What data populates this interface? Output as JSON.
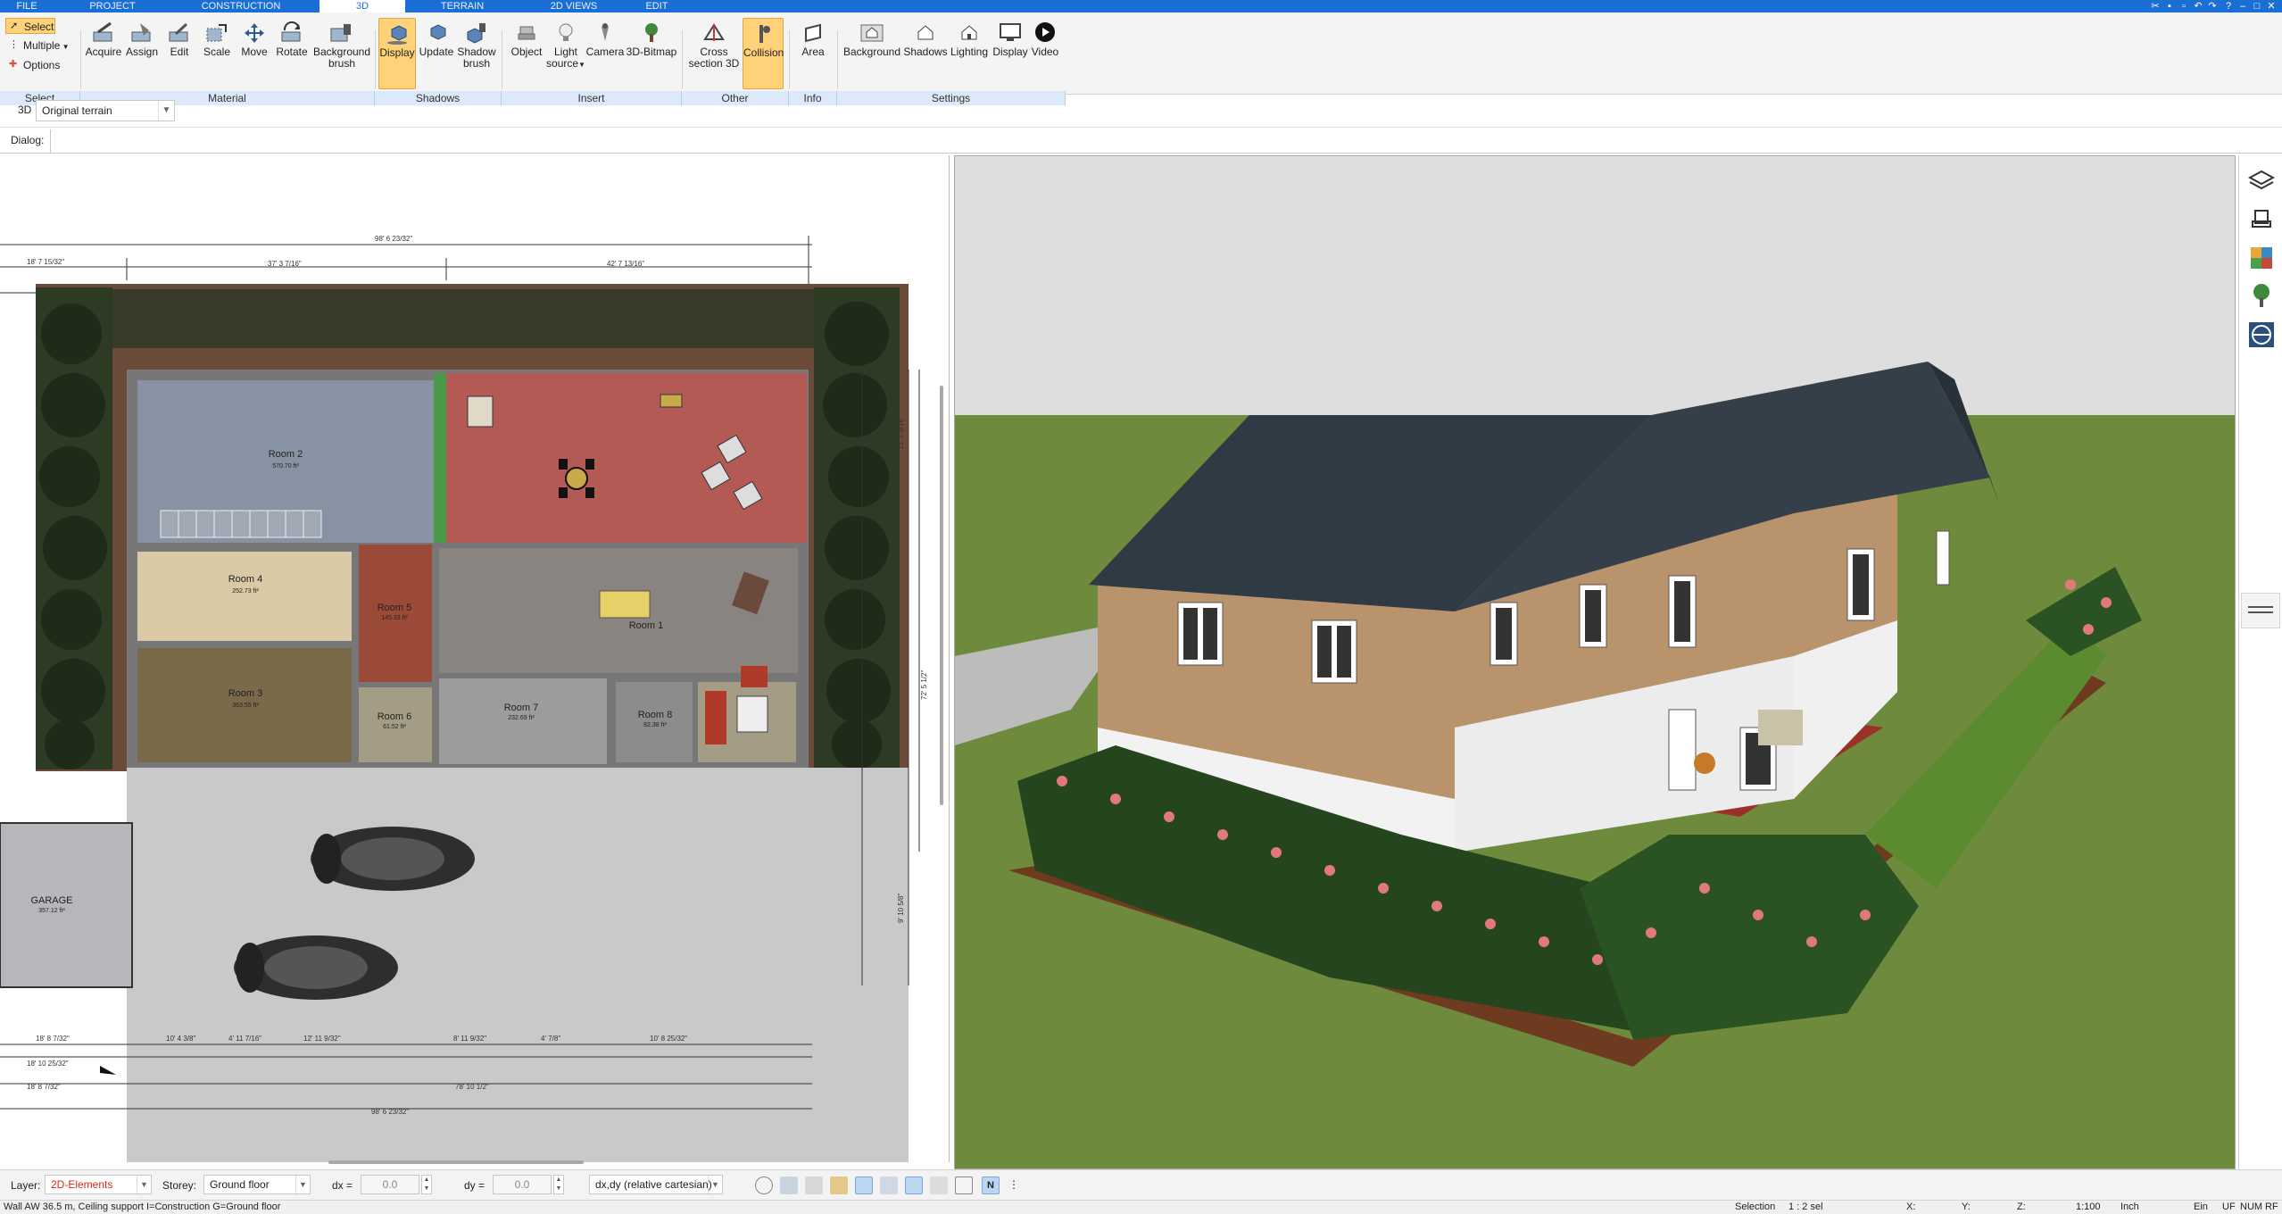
{
  "tabs": [
    {
      "label": "FILE"
    },
    {
      "label": "PROJECT"
    },
    {
      "label": "CONSTRUCTION"
    },
    {
      "label": "3D"
    },
    {
      "label": "TERRAIN"
    },
    {
      "label": "2D VIEWS"
    },
    {
      "label": "EDIT"
    }
  ],
  "ribbon": {
    "select_group": {
      "select": "Select",
      "multiple": "Multiple",
      "options": "Options",
      "caption": "Select"
    },
    "material_group": {
      "acquire": "Acquire",
      "assign": "Assign",
      "edit": "Edit",
      "scale": "Scale",
      "move": "Move",
      "rotate": "Rotate",
      "background_brush_1": "Background",
      "background_brush_2": "brush",
      "caption": "Material"
    },
    "shadows_group": {
      "display": "Display",
      "update": "Update",
      "shadow_brush_1": "Shadow",
      "shadow_brush_2": "brush",
      "caption": "Shadows"
    },
    "insert_group": {
      "object": "Object",
      "light_source_1": "Light",
      "light_source_2": "source",
      "camera": "Camera",
      "bitmap": "3D-Bitmap",
      "caption": "Insert"
    },
    "other_group": {
      "cross_section_1": "Cross",
      "cross_section_2": "section 3D",
      "collision": "Collision",
      "caption": "Other"
    },
    "info_group": {
      "area": "Area",
      "caption": "Info"
    },
    "settings_group": {
      "background": "Background",
      "shadows": "Shadows",
      "lighting": "Lighting",
      "display": "Display",
      "video": "Video",
      "caption": "Settings"
    }
  },
  "view_row": {
    "mode": "3D",
    "terrain_value": "Original terrain"
  },
  "dialog_row": {
    "label": "Dialog:"
  },
  "plan": {
    "rooms": [
      {
        "name": "Room 2",
        "area": "570.70 ft²"
      },
      {
        "name": "Room 4",
        "area": "252.73 ft²"
      },
      {
        "name": "Room 3",
        "area": "363.55 ft²"
      },
      {
        "name": "Room 5",
        "area": "145.33 ft²"
      },
      {
        "name": "Room 1",
        "area": ""
      },
      {
        "name": "Room 6",
        "area": "61.52 ft²"
      },
      {
        "name": "Room 7",
        "area": "232.69 ft²"
      },
      {
        "name": "Room 8",
        "area": "82.38 ft²"
      },
      {
        "name": "GARAGE",
        "area": "357.12 ft²"
      }
    ],
    "dims_top": [
      "98' 6 23/32\"",
      "18' 7 15/32\"",
      "37' 3 7/16\"",
      "42' 7 13/16\""
    ],
    "dims_bottom": [
      "18' 8 7/32\"",
      "10' 4 3/8\"",
      "4' 11 7/16\"",
      "12' 11 9/32\"",
      "8' 11 9/32\"",
      "4' 7/8\"",
      "10' 8 25/32\"",
      "18' 10 25/32\"",
      "18' 8 7/32\"",
      "78' 10 1/2\"",
      "98' 6 23/32\""
    ],
    "dims_right": [
      "72' 5 1/2\"",
      "13' 1 3/16\"",
      "9' 10 5/8\""
    ]
  },
  "bottom": {
    "layer_label": "Layer:",
    "layer_value": "2D-Elements",
    "storey_label": "Storey:",
    "storey_value": "Ground floor",
    "dx_label": "dx =",
    "dx_value": "0.0",
    "dy_label": "dy =",
    "dy_value": "0.0",
    "coord_mode": "dx,dy (relative cartesian)"
  },
  "status": {
    "message": "Wall AW 36.5 m, Ceiling support I=Construction G=Ground floor",
    "selection_label": "Selection",
    "selection_value": "1 : 2 sel",
    "x_label": "X:",
    "y_label": "Y:",
    "z_label": "Z:",
    "scale": "1:100",
    "unit": "Inch",
    "ein": "Ein",
    "uf": "UF",
    "num": "NUM",
    "rf": "RF"
  },
  "colors": {
    "tabbar": "#1b6fd4",
    "ribbon_highlight": "#ffd27a",
    "group_bar": "#dce9f8",
    "sky": "#dedede",
    "grass": "#6e8b3d",
    "roof": "#2f3a45",
    "wood": "#b8936c",
    "terrace": "#a3342e"
  },
  "icons": [
    "layers-icon",
    "chair-icon",
    "materials-icon",
    "tree-icon",
    "measure-icon"
  ]
}
